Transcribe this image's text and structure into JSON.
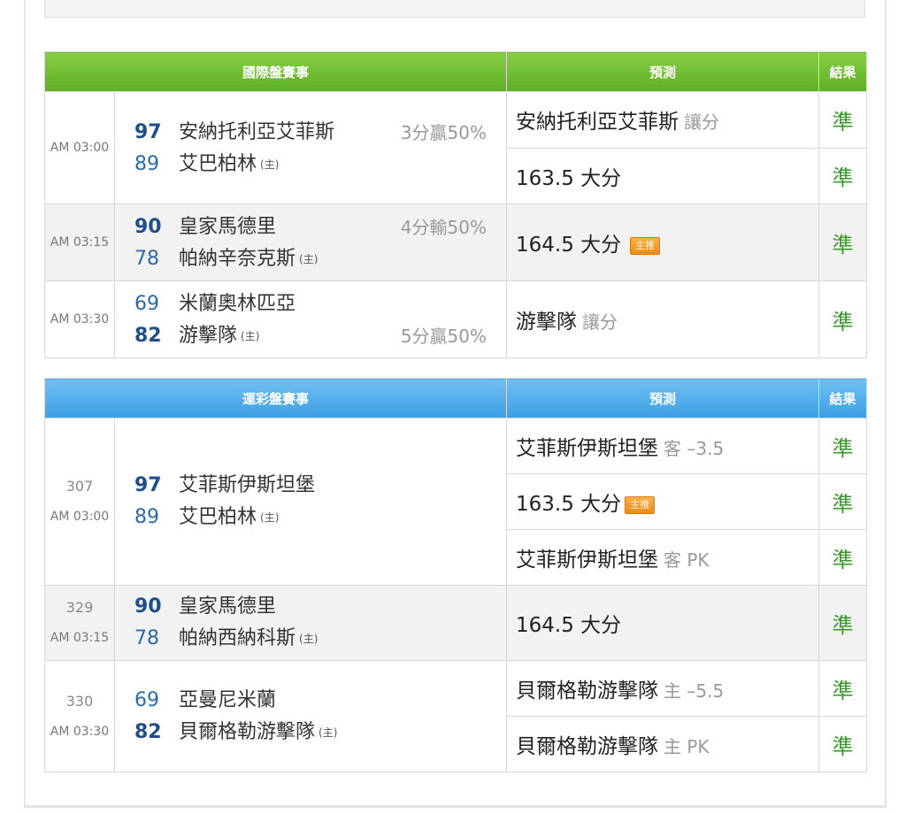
{
  "international": {
    "headers": {
      "match": "國際盤賽事",
      "prediction": "預測",
      "result": "結果"
    },
    "games": [
      {
        "time": "AM 03:00",
        "away": {
          "score": "97",
          "team": "安納托利亞艾菲斯",
          "win": true
        },
        "home": {
          "score": "89",
          "team": "艾巴柏林",
          "tag": "(主)"
        },
        "handicap": "3分贏50%",
        "handicap_row": "away",
        "predictions": [
          {
            "main": "安納托利亞艾菲斯",
            "sub": "讓分",
            "result": "準"
          },
          {
            "main": "163.5 大分",
            "sub": "",
            "result": "準"
          }
        ]
      },
      {
        "time": "AM 03:15",
        "away": {
          "score": "90",
          "team": "皇家馬德里",
          "win": true
        },
        "home": {
          "score": "78",
          "team": "帕納辛奈克斯",
          "tag": "(主)"
        },
        "handicap": "4分輸50%",
        "predictions": [
          {
            "main": "164.5 大分",
            "badge": "主推",
            "result": "準"
          }
        ]
      },
      {
        "time": "AM 03:30",
        "away": {
          "score": "69",
          "team": "米蘭奧林匹亞"
        },
        "home": {
          "score": "82",
          "team": "游擊隊",
          "tag": "(主)",
          "win": true
        },
        "handicap": "5分贏50%",
        "predictions": [
          {
            "main": "游擊隊",
            "sub": "讓分",
            "result": "準"
          }
        ]
      }
    ]
  },
  "lottery": {
    "headers": {
      "match": "運彩盤賽事",
      "prediction": "預測",
      "result": "結果"
    },
    "games": [
      {
        "number": "307",
        "time": "AM 03:00",
        "away": {
          "score": "97",
          "team": "艾菲斯伊斯坦堡",
          "win": true
        },
        "home": {
          "score": "89",
          "team": "艾巴柏林",
          "tag": "(主)"
        },
        "predictions": [
          {
            "main": "艾菲斯伊斯坦堡",
            "sub": "客 –3.5",
            "result": "準"
          },
          {
            "main": "163.5 大分",
            "badge": "主推",
            "result": "準"
          },
          {
            "main": "艾菲斯伊斯坦堡",
            "sub": "客 PK",
            "result": "準"
          }
        ]
      },
      {
        "number": "329",
        "time": "AM 03:15",
        "away": {
          "score": "90",
          "team": "皇家馬德里",
          "win": true
        },
        "home": {
          "score": "78",
          "team": "帕納西納科斯",
          "tag": "(主)"
        },
        "predictions": [
          {
            "main": "164.5 大分",
            "result": "準"
          }
        ]
      },
      {
        "number": "330",
        "time": "AM 03:30",
        "away": {
          "score": "69",
          "team": "亞曼尼米蘭"
        },
        "home": {
          "score": "82",
          "team": "貝爾格勒游擊隊",
          "tag": "(主)",
          "win": true
        },
        "predictions": [
          {
            "main": "貝爾格勒游擊隊",
            "sub": "主 –5.5",
            "result": "準"
          },
          {
            "main": "貝爾格勒游擊隊",
            "sub": "主 PK",
            "result": "準"
          }
        ]
      }
    ]
  },
  "colors": {
    "green_header": "#6dbb2e",
    "blue_header": "#4aa8e8",
    "result_green": "#3a9a2b",
    "score_blue": "#1e4f86",
    "badge_orange": "#ee9a2a"
  }
}
